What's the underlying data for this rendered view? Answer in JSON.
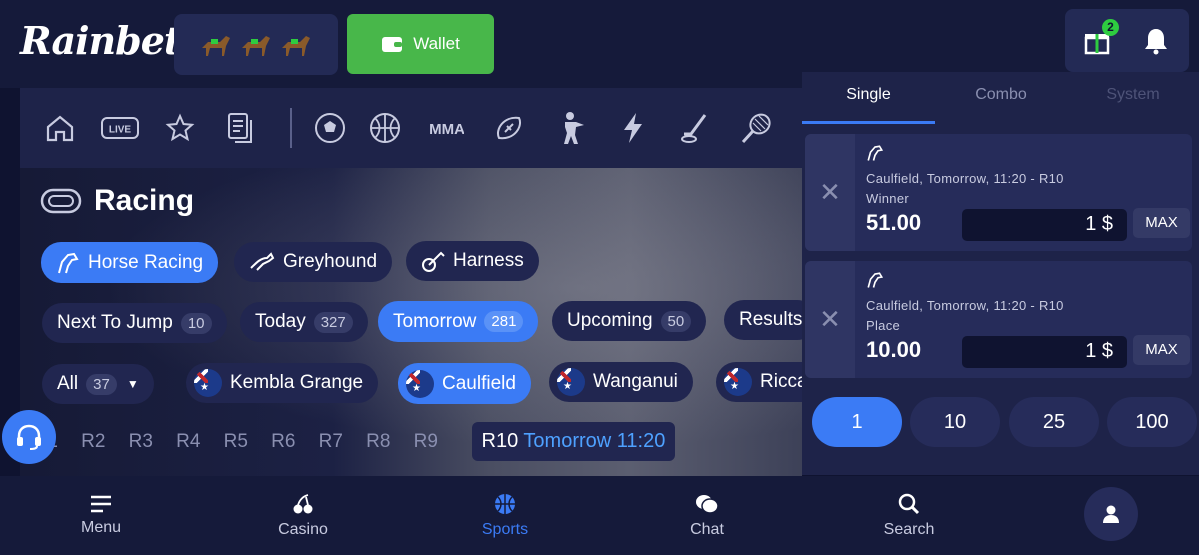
{
  "header": {
    "logo": "Rainbet",
    "wallet_label": "Wallet",
    "gift_badge": "2"
  },
  "sport_bar": {
    "icons": [
      "home-icon",
      "live-icon",
      "star-icon",
      "betslip-icon",
      "soccer-icon",
      "basketball-icon",
      "mma-icon",
      "football-icon",
      "esports-icon",
      "lightning-icon",
      "hockey-icon",
      "tennis-icon"
    ],
    "live_label": "LIVE",
    "mma_label": "MMA"
  },
  "racing": {
    "title": "Racing",
    "types": [
      "Horse Racing",
      "Greyhound",
      "Harness"
    ],
    "filters": [
      {
        "label": "Next To Jump",
        "count": "10"
      },
      {
        "label": "Today",
        "count": "327"
      },
      {
        "label": "Tomorrow",
        "count": "281"
      },
      {
        "label": "Upcoming",
        "count": "50"
      },
      {
        "label": "Results",
        "count": ""
      }
    ],
    "all": {
      "label": "All",
      "count": "37"
    },
    "venues": [
      "Kembla Grange",
      "Caulfield",
      "Wanganui",
      "Ricca"
    ],
    "races": [
      "R1",
      "R2",
      "R3",
      "R4",
      "R5",
      "R6",
      "R7",
      "R8",
      "R9"
    ],
    "current_race": "R10",
    "current_race_time": "Tomorrow 11:20"
  },
  "betslip": {
    "tabs": [
      "Single",
      "Combo",
      "System"
    ],
    "bets": [
      {
        "event": "Caulfield, Tomorrow, 11:20 - R10",
        "market": "Winner",
        "odds": "51.00",
        "stake": "1 $",
        "max": "MAX"
      },
      {
        "event": "Caulfield, Tomorrow, 11:20 - R10",
        "market": "Place",
        "odds": "10.00",
        "stake": "1 $",
        "max": "MAX"
      }
    ],
    "quick_stakes": [
      "1",
      "10",
      "25",
      "100"
    ]
  },
  "bottom_nav": [
    "Menu",
    "Casino",
    "Sports",
    "Chat",
    "Search"
  ],
  "colors": {
    "accent": "#3b7bf5",
    "wallet": "#48b74a",
    "bg": "#0f1330"
  }
}
